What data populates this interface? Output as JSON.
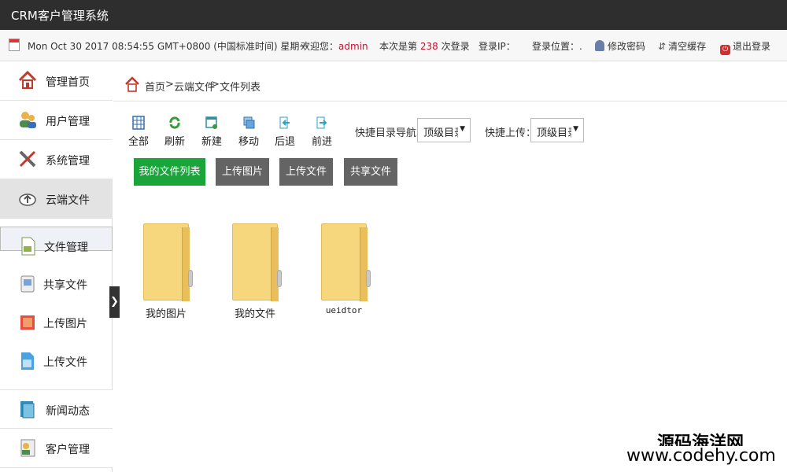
{
  "app": {
    "title": "CRM客户管理系统"
  },
  "info": {
    "datetime": "Mon Oct 30 2017 08:54:55 GMT+0800 (中国标准时间) 星期一",
    "welcome_prefix": "欢迎您：",
    "user": "admin",
    "login_prefix": "本次是第",
    "login_count": "238",
    "login_suffix": "次登录",
    "login_ip": "登录IP：",
    "login_loc": "登录位置：.",
    "change_pwd": "修改密码",
    "clear_cache": "清空缓存",
    "logout": "退出登录"
  },
  "sidebar": {
    "items": [
      {
        "label": "管理首页",
        "icon": "home-icon"
      },
      {
        "label": "用户管理",
        "icon": "users-icon"
      },
      {
        "label": "系统管理",
        "icon": "tools-icon"
      },
      {
        "label": "云端文件",
        "icon": "cloud-icon"
      }
    ],
    "sub": [
      {
        "label": "文件管理",
        "icon": "file-icon"
      },
      {
        "label": "共享文件",
        "icon": "share-icon"
      },
      {
        "label": "上传图片",
        "icon": "image-icon"
      },
      {
        "label": "上传文件",
        "icon": "upload-file-icon"
      }
    ],
    "items2": [
      {
        "label": "新闻动态",
        "icon": "news-icon"
      },
      {
        "label": "客户管理",
        "icon": "customer-icon"
      }
    ],
    "toggle": "❯"
  },
  "breadcrumb": [
    "首页",
    "&gt;",
    "云端文件",
    "&gt;",
    "文件列表"
  ],
  "toolbar": {
    "all": "全部",
    "refresh": "刷新",
    "new": "新建",
    "move": "移动",
    "back": "后退",
    "forward": "前进"
  },
  "quick": {
    "nav_label": "快捷目录导航：",
    "nav_value": "顶级目录",
    "upload_label": "快捷上传：",
    "upload_value": "顶级目录"
  },
  "buttons": {
    "my_files": "我的文件列表",
    "upload_image": "上传图片",
    "upload_file": "上传文件",
    "share": "共享文件"
  },
  "folders": [
    "我的图片",
    "我的文件",
    "ueidtor"
  ],
  "watermark": {
    "line1": "源码海洋网",
    "line2": "www.codehy.com"
  },
  "colors": {
    "accent_green": "#1aa53a",
    "header": "#2e2e2e",
    "user_red": "#c8102e"
  }
}
